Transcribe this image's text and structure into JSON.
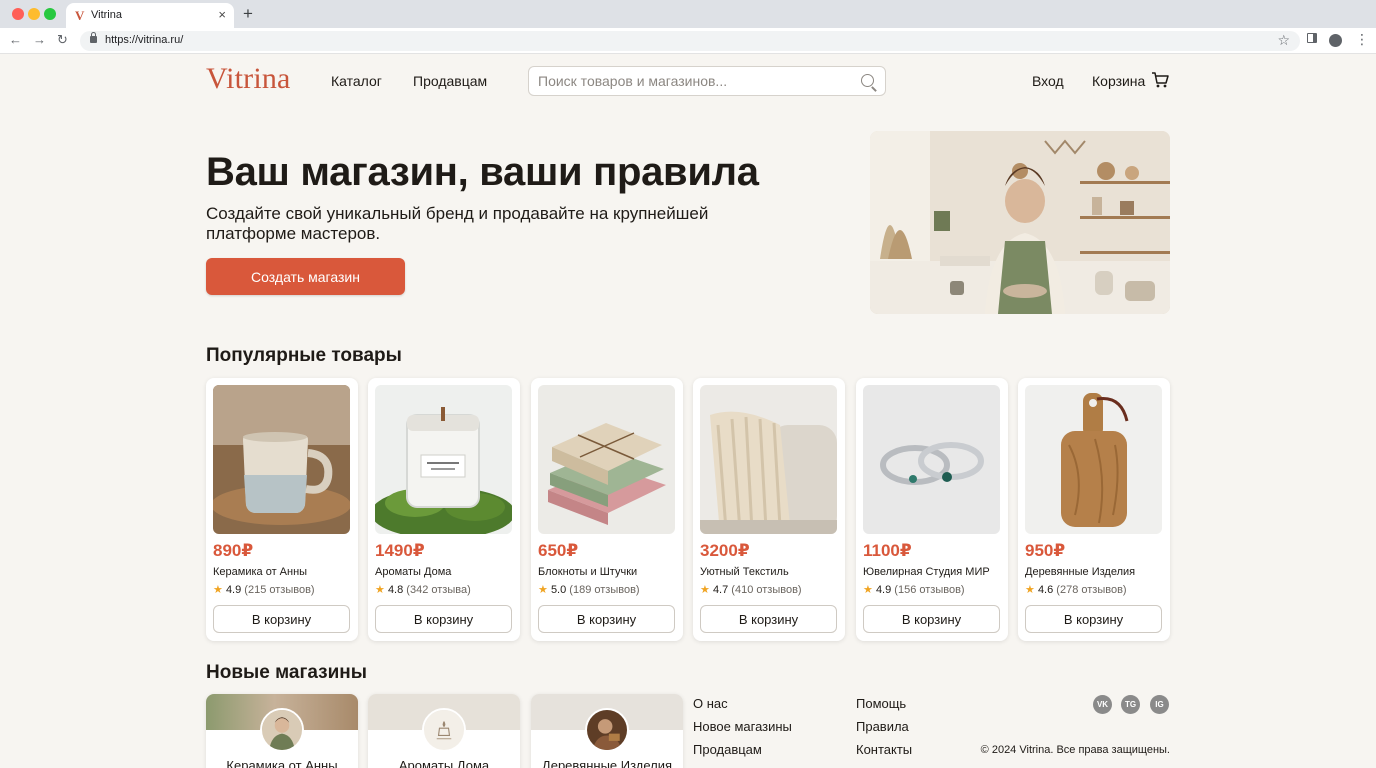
{
  "browser": {
    "tab_title": "Vitrina",
    "tab_favicon": "V",
    "url": "https://vitrina.ru/",
    "new_tab": "+",
    "close_tab": "×"
  },
  "header": {
    "logo": "Vitrina",
    "nav": [
      "Каталог",
      "Продавцам"
    ],
    "search_placeholder": "Поиск товаров и магазинов...",
    "login": "Вход",
    "cart": "Корзина"
  },
  "hero": {
    "title": "Ваш магазин, ваши правила",
    "subtitle": "Создайте свой уникальный бренд и продавайте на крупнейшей платформе мастеров.",
    "cta": "Создать магазин",
    "image": "smiling-artisan-in-studio"
  },
  "popular": {
    "title": "Популярные товары",
    "button_label": "В корзину",
    "products": [
      {
        "price": "890₽",
        "shop": "Керамика от Анны",
        "rating": "4.9",
        "reviews": "(215 отзывов)",
        "image": "ceramic-mug"
      },
      {
        "price": "1490₽",
        "shop": "Ароматы Дома",
        "rating": "4.8",
        "reviews": "(342 отзыва)",
        "image": "candle-in-glass"
      },
      {
        "price": "650₽",
        "shop": "Блокноты и Штучки",
        "rating": "5.0",
        "reviews": "(189 отзывов)",
        "image": "stack-of-notebooks"
      },
      {
        "price": "3200₽",
        "shop": "Уютный Текстиль",
        "rating": "4.7",
        "reviews": "(410 отзывов)",
        "image": "knitted-blanket"
      },
      {
        "price": "1100₽",
        "shop": "Ювелирная Студия МИР",
        "rating": "4.9",
        "reviews": "(156 отзывов)",
        "image": "silver-rings"
      },
      {
        "price": "950₽",
        "shop": "Деревянные Изделия",
        "rating": "4.6",
        "reviews": "(278 отзывов)",
        "image": "wooden-cutting-board"
      }
    ]
  },
  "new_shops": {
    "title": "Новые магазины",
    "shops": [
      {
        "name": "Керамика от Анны"
      },
      {
        "name": "Ароматы Дома"
      },
      {
        "name": "Деревянные Изделия"
      }
    ]
  },
  "footer": {
    "col1": [
      "О нас",
      "Новое магазины",
      "Продавцам"
    ],
    "col2": [
      "Помощь",
      "Правила",
      "Контакты"
    ],
    "social": [
      {
        "icon": "vk-icon",
        "label": "VK"
      },
      {
        "icon": "telegram-icon",
        "label": "TG"
      },
      {
        "icon": "instagram-icon",
        "label": "IG"
      }
    ],
    "copyright": "© 2024 Vitrina. Все права защищены."
  },
  "colors": {
    "brand": "#c8553b",
    "accent": "#d9583b",
    "background": "#f7f5f1",
    "star": "#f0a422"
  }
}
